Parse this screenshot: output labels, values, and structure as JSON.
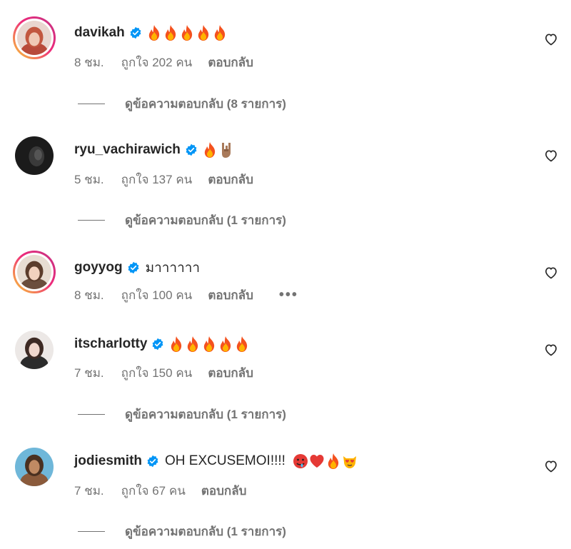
{
  "comments": [
    {
      "username": "davikah",
      "text": "",
      "emojis": [
        "fire",
        "fire",
        "fire",
        "fire",
        "fire"
      ],
      "time": "8 ชม.",
      "likes": "ถูกใจ 202 คน",
      "reply": "ตอบกลับ",
      "view_replies": "ดูข้อความตอบกลับ (8 รายการ)",
      "story_ring": true
    },
    {
      "username": "ryu_vachirawich",
      "text": "",
      "emojis": [
        "fire",
        "horns-hand"
      ],
      "time": "5 ชม.",
      "likes": "ถูกใจ 137 คน",
      "reply": "ตอบกลับ",
      "view_replies": "ดูข้อความตอบกลับ (1 รายการ)",
      "story_ring": false
    },
    {
      "username": "goyyog",
      "text": "มาาาาาา",
      "emojis": [],
      "time": "8 ชม.",
      "likes": "ถูกใจ 100 คน",
      "reply": "ตอบกลับ",
      "more": "•••",
      "story_ring": true
    },
    {
      "username": "itscharlotty",
      "text": "",
      "emojis": [
        "fire",
        "fire",
        "fire",
        "fire",
        "fire"
      ],
      "time": "7 ชม.",
      "likes": "ถูกใจ 150 คน",
      "reply": "ตอบกลับ",
      "view_replies": "ดูข้อความตอบกลับ (1 รายการ)",
      "story_ring": false
    },
    {
      "username": "jodiesmith",
      "text": "OH EXCUSEMOI!!!!",
      "emojis": [
        "drooling-face",
        "red-heart",
        "fire",
        "heart-eyes-cat"
      ],
      "time": "7 ชม.",
      "likes": "ถูกใจ 67 คน",
      "reply": "ตอบกลับ",
      "view_replies": "ดูข้อความตอบกลับ (1 รายการ)",
      "story_ring": false
    }
  ],
  "colors": {
    "text": "#262626",
    "secondary": "#737373",
    "verified": "#0095f6",
    "ring_start": "#f9ce34",
    "ring_end": "#c13584"
  }
}
